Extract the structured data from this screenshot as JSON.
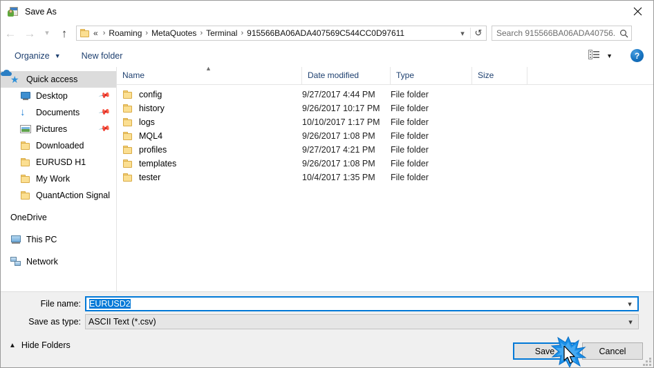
{
  "window": {
    "title": "Save As",
    "title_icon": "save-as-icon",
    "close_icon": "close-icon"
  },
  "nav": {
    "back_icon": "arrow-left-icon",
    "forward_icon": "arrow-right-icon",
    "recent_icon": "chevron-down-icon",
    "up_icon": "arrow-up-icon",
    "address": {
      "folder_icon": "folder-icon",
      "lead": "«",
      "crumbs": [
        "Roaming",
        "MetaQuotes",
        "Terminal",
        "915566BA06ADA407569C544CC0D97611"
      ],
      "separator": "›",
      "dropdown_icon": "chevron-down-icon",
      "refresh_icon": "refresh-icon",
      "refresh_glyph": "↺"
    },
    "search": {
      "placeholder": "Search 915566BA06ADA40756...",
      "value": "",
      "icon": "search-icon"
    }
  },
  "commandbar": {
    "organize_label": "Organize",
    "organize_caret": "▼",
    "new_folder_label": "New folder",
    "view_icon": "view-layout-icon",
    "view_caret": "▼",
    "help_label": "?",
    "help_icon": "help-icon"
  },
  "sidebar": {
    "items": [
      {
        "label": "Quick access",
        "icon": "star-icon",
        "selected": true,
        "indent": false,
        "pinned": false,
        "gap": false
      },
      {
        "label": "Desktop",
        "icon": "desktop-icon",
        "selected": false,
        "indent": true,
        "pinned": true,
        "gap": false
      },
      {
        "label": "Documents",
        "icon": "documents-icon",
        "selected": false,
        "indent": true,
        "pinned": true,
        "gap": false
      },
      {
        "label": "Pictures",
        "icon": "pictures-icon",
        "selected": false,
        "indent": true,
        "pinned": true,
        "gap": false
      },
      {
        "label": "Downloaded",
        "icon": "folder-icon",
        "selected": false,
        "indent": true,
        "pinned": false,
        "gap": false
      },
      {
        "label": "EURUSD H1",
        "icon": "folder-icon",
        "selected": false,
        "indent": true,
        "pinned": false,
        "gap": false
      },
      {
        "label": "My Work",
        "icon": "folder-icon",
        "selected": false,
        "indent": true,
        "pinned": false,
        "gap": false
      },
      {
        "label": "QuantAction Signal",
        "icon": "folder-icon",
        "selected": false,
        "indent": true,
        "pinned": false,
        "gap": false
      },
      {
        "label": "OneDrive",
        "icon": "cloud-icon",
        "selected": false,
        "indent": false,
        "pinned": false,
        "gap": true
      },
      {
        "label": "This PC",
        "icon": "computer-icon",
        "selected": false,
        "indent": false,
        "pinned": false,
        "gap": true
      },
      {
        "label": "Network",
        "icon": "network-icon",
        "selected": false,
        "indent": false,
        "pinned": false,
        "gap": true
      }
    ],
    "pin_glyph": "📌"
  },
  "filelist": {
    "columns": [
      "Name",
      "Date modified",
      "Type",
      "Size"
    ],
    "sort_indicator": "▲",
    "rows": [
      {
        "name": "config",
        "date": "9/27/2017 4:44 PM",
        "type": "File folder",
        "size": ""
      },
      {
        "name": "history",
        "date": "9/26/2017 10:17 PM",
        "type": "File folder",
        "size": ""
      },
      {
        "name": "logs",
        "date": "10/10/2017 1:17 PM",
        "type": "File folder",
        "size": ""
      },
      {
        "name": "MQL4",
        "date": "9/26/2017 1:08 PM",
        "type": "File folder",
        "size": ""
      },
      {
        "name": "profiles",
        "date": "9/27/2017 4:21 PM",
        "type": "File folder",
        "size": ""
      },
      {
        "name": "templates",
        "date": "9/26/2017 1:08 PM",
        "type": "File folder",
        "size": ""
      },
      {
        "name": "tester",
        "date": "10/4/2017 1:35 PM",
        "type": "File folder",
        "size": ""
      }
    ]
  },
  "form": {
    "filename_label": "File name:",
    "filename_value": "EURUSD2",
    "filename_dropdown_icon": "chevron-down-icon",
    "filetype_label": "Save as type:",
    "filetype_value": "ASCII Text (*.csv)",
    "filetype_dropdown_icon": "chevron-down-icon"
  },
  "footer": {
    "hide_folders_label": "Hide Folders",
    "hide_folders_icon": "chevron-up-icon",
    "save_label": "Save",
    "cancel_label": "Cancel",
    "resize_grip_icon": "resize-grip-icon",
    "click_burst_icon": "click-burst-icon",
    "cursor_icon": "mouse-cursor-icon"
  },
  "colors": {
    "accent": "#0078d7",
    "folder_yellow": "#fbdf92",
    "link_navy": "#1d3f6f",
    "dialog_bg": "#f0f0f0"
  }
}
